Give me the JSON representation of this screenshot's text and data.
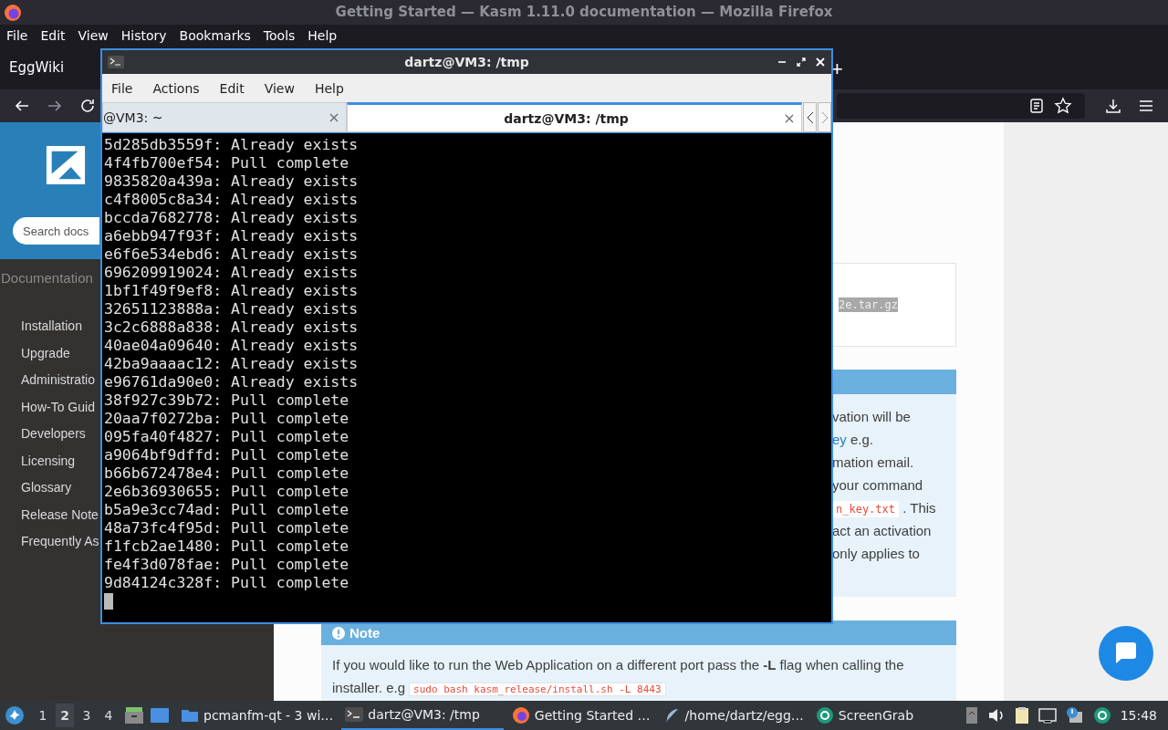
{
  "browser": {
    "title": "Getting Started — Kasm 1.11.0 documentation — Mozilla Firefox",
    "menu": [
      "File",
      "Edit",
      "View",
      "History",
      "Bookmarks",
      "Tools",
      "Help"
    ],
    "tab": {
      "label": "EggWiki"
    },
    "new_tab": "+",
    "sidebar": {
      "search_placeholder": "Search docs",
      "caption": "Documentation",
      "items": [
        "Installation",
        "Upgrade",
        "Administratio",
        "How-To Guid",
        "Developers",
        "Licensing",
        "Glossary",
        "Release Note",
        "Frequently As"
      ]
    },
    "code_fragment": "2e.tar.gz",
    "admonition_lines": [
      [
        {
          "kind": "text",
          "text": "vation will be"
        }
      ],
      [
        {
          "kind": "link",
          "text": "ey"
        },
        {
          "kind": "text",
          "text": " e.g."
        }
      ],
      [
        {
          "kind": "text",
          "text": "mation email."
        }
      ],
      [
        {
          "kind": "text",
          "text": "your command"
        }
      ],
      [
        {
          "kind": "code",
          "text": "n_key.txt"
        },
        {
          "kind": "text",
          "text": " . This"
        }
      ],
      [
        {
          "kind": "text",
          "text": "act an activation"
        }
      ],
      [
        {
          "kind": "text",
          "text": "only applies to"
        }
      ]
    ],
    "note": {
      "title": "Note",
      "text": "If you would like to run the Web Application on a different port pass the **-L** flag when calling the installer. e.g",
      "code": "sudo bash kasm_release/install.sh -L 8443"
    }
  },
  "terminal": {
    "title": "dartz@VM3: /tmp",
    "menu": [
      "File",
      "Actions",
      "Edit",
      "View",
      "Help"
    ],
    "tabs": [
      {
        "label": "@VM3: ~",
        "selected": false
      },
      {
        "label": "dartz@VM3: /tmp",
        "selected": true
      }
    ],
    "lines": [
      "5d285db3559f: Already exists",
      "4f4fb700ef54: Pull complete",
      "9835820a439a: Already exists",
      "c4f8005c8a34: Already exists",
      "bccda7682778: Already exists",
      "a6ebb947f93f: Already exists",
      "e6f6e534ebd6: Already exists",
      "696209919024: Already exists",
      "1bf1f49f9ef8: Already exists",
      "32651123888a: Already exists",
      "3c2c6888a838: Already exists",
      "40ae04a09640: Already exists",
      "42ba9aaaac12: Already exists",
      "e96761da90e0: Already exists",
      "38f927c39b72: Pull complete",
      "20aa7f0272ba: Pull complete",
      "095fa40f4827: Pull complete",
      "a9064bf9dffd: Pull complete",
      "b66b672478e4: Pull complete",
      "2e6b36930655: Pull complete",
      "b5a9e3cc74ad: Pull complete",
      "48a73fc4f95d: Pull complete",
      "f1fcb2ae1480: Pull complete",
      "fe4f3d078fae: Pull complete",
      "9d84124c328f: Pull complete"
    ]
  },
  "taskbar": {
    "workspaces": [
      {
        "label": "1",
        "selected": false
      },
      {
        "label": "2",
        "selected": true
      },
      {
        "label": "3",
        "selected": false
      },
      {
        "label": "4",
        "selected": false
      }
    ],
    "tasks": [
      {
        "kind": "folder",
        "label": "pcmanfm-qt - 3 wi…",
        "selected": false
      },
      {
        "kind": "terminal",
        "label": "dartz@VM3: /tmp",
        "selected": true
      },
      {
        "kind": "firefox",
        "label": "Getting Started …",
        "selected": false
      },
      {
        "kind": "feather",
        "label": "/home/dartz/egg…",
        "selected": false
      },
      {
        "kind": "screengrab",
        "label": "ScreenGrab",
        "selected": false
      }
    ],
    "clock": "15:48"
  }
}
